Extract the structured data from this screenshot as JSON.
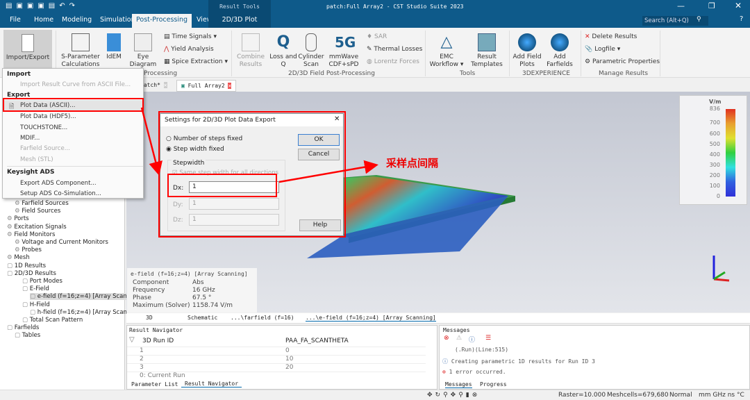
{
  "title": "patch:Full Array2 - CST Studio Suite 2023",
  "context_tab": "Result Tools",
  "search_placeholder": "Search (Alt+Q)",
  "menu_tabs": [
    "File",
    "Home",
    "Modeling",
    "Simulation",
    "Post-Processing",
    "View",
    "2D/3D Plot"
  ],
  "ribbon": {
    "import_export": "Import/Export",
    "sparam": "S-Parameter Calculations",
    "idem": "IdEM",
    "eye": "Eye Diagram",
    "time_signals": "Time Signals",
    "yield": "Yield Analysis",
    "spice": "Spice Extraction",
    "combine": "Combine Results",
    "loss": "Loss and Q",
    "cylinder": "Cylinder Scan",
    "mmwave": "mmWave CDF+sPD",
    "sar": "SAR",
    "thermal": "Thermal Losses",
    "lorentz": "Lorentz Forces",
    "emc": "EMC Workflow",
    "templates": "Result Templates",
    "add_field": "Add Field Plots",
    "add_farfields": "Add Farfields",
    "delete": "Delete Results",
    "logfile": "Logfile",
    "param_props": "Parametric Properties",
    "groups": [
      "Processing",
      "2D/3D Field Post-Processing",
      "Tools",
      "3DEXPERIENCE",
      "Manage Results"
    ]
  },
  "doc_tabs": [
    "patch*",
    "Full Array2"
  ],
  "menu": {
    "import_header": "Import",
    "import_curve": "Import Result Curve from ASCII File...",
    "export_header": "Export",
    "items": [
      "Plot Data (ASCII)...",
      "Plot Data (HDF5)...",
      "TOUCHSTONE...",
      "MDIF...",
      "Farfield Source...",
      "Mesh (STL)"
    ],
    "keysight_header": "Keysight ADS",
    "keysight_items": [
      "Export ADS Component...",
      "Setup ADS Co-Simulation..."
    ]
  },
  "tree": [
    "Farfield Sources",
    "Field Sources",
    "Ports",
    "Excitation Signals",
    "Field Monitors",
    "Voltage and Current Monitors",
    "Probes",
    "Mesh",
    "1D Results",
    "2D/3D Results",
    "Port Modes",
    "E-Field",
    "e-field (f=16;z=4) [Array Scan",
    "H-Field",
    "h-field (f=16;z=4) [Array Scan",
    "Total Scan Pattern",
    "Farfields",
    "Tables"
  ],
  "dialog": {
    "title": "Settings for 2D/3D Plot Data Export",
    "radio1": "Number of steps fixed",
    "radio2": "Step width fixed",
    "selected": "Step width fixed",
    "group": "Stepwidth",
    "same": "Same step width for all directions",
    "dx_label": "Dx:",
    "dx": "1",
    "dy_label": "Dy:",
    "dy": "1",
    "dz_label": "Dz:",
    "dz": "1",
    "ok": "OK",
    "cancel": "Cancel",
    "help": "Help"
  },
  "annotation": "采样点间隔",
  "colorbar": {
    "unit": "V/m",
    "ticks": [
      "836",
      "700",
      "600",
      "500",
      "400",
      "300",
      "200",
      "100",
      "0"
    ]
  },
  "info": {
    "title": "e-field (f=16;z=4) [Array Scanning]",
    "rows": [
      [
        "Component",
        "Abs"
      ],
      [
        "Frequency",
        "16 GHz"
      ],
      [
        "Phase",
        "67.5 °"
      ],
      [
        "Maximum (Solver)",
        "1158.74 V/m"
      ]
    ]
  },
  "view_tabs": [
    "3D",
    "Schematic",
    "...\\farfield (f=16)",
    "...\\e-field (f=16;z=4) [Array Scanning]"
  ],
  "result_nav": {
    "title": "Result Navigator",
    "cols": [
      "3D Run ID",
      "PAA_FA_SCANTHETA"
    ],
    "rows": [
      [
        "1",
        "0"
      ],
      [
        "2",
        "10"
      ],
      [
        "3",
        "20"
      ],
      [
        "0: Current Run",
        ""
      ]
    ],
    "tabs": [
      "Parameter List",
      "Result Navigator"
    ]
  },
  "messages": {
    "title": "Messages",
    "lines": [
      "(.Run)(Line:515)",
      "Creating parametric 1D results for Run ID 3",
      "1 error occurred."
    ],
    "tabs": [
      "Messages",
      "Progress"
    ]
  },
  "status": {
    "raster": "Raster=10.000",
    "meshcells": "Meshcells=679,680",
    "mode": "Normal",
    "units": "mm  GHz  ns  °C"
  },
  "colors": {
    "brand": "#0e5a8a",
    "annotation": "#ff0000"
  }
}
